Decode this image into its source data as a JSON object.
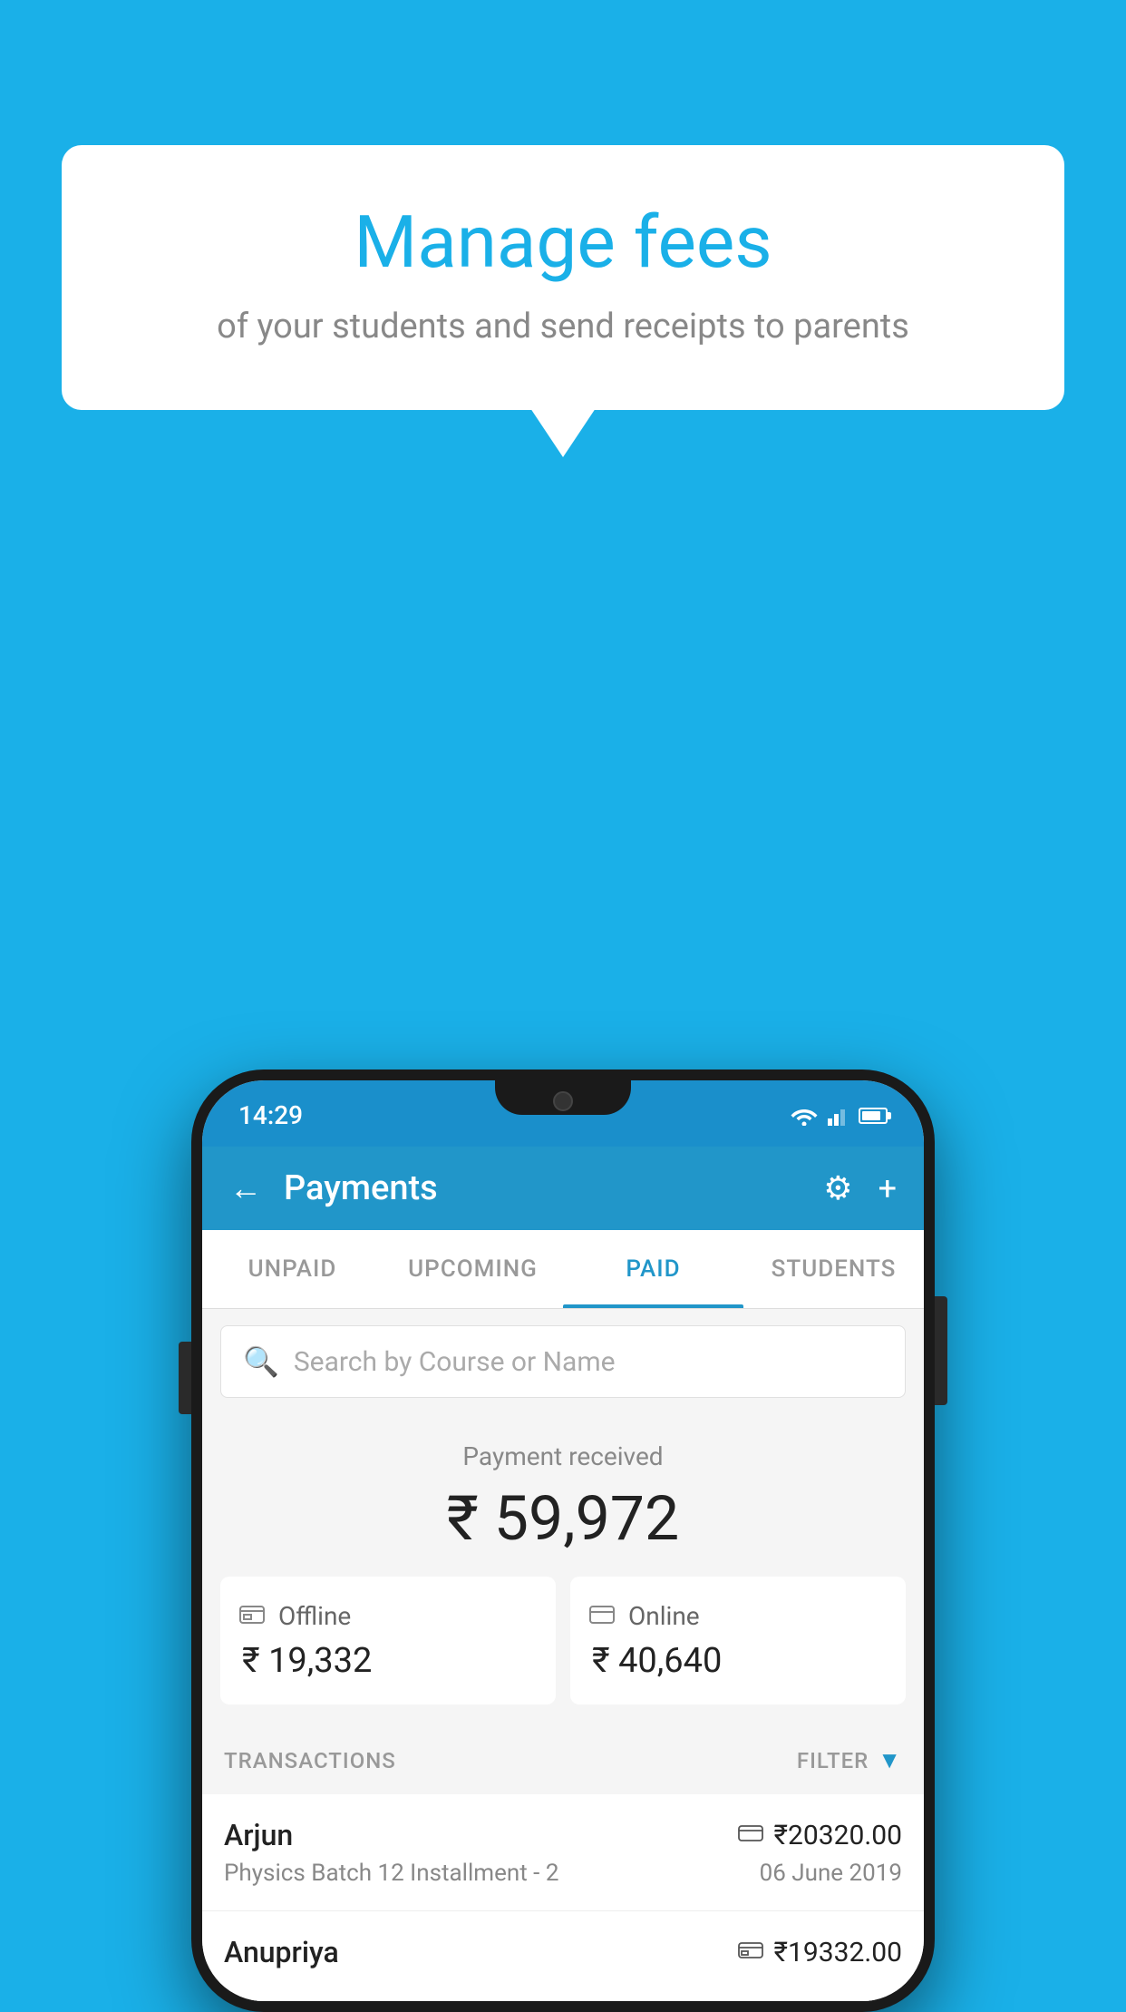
{
  "background_color": "#1ab0e8",
  "speech_bubble": {
    "title": "Manage fees",
    "subtitle": "of your students and send receipts to parents"
  },
  "status_bar": {
    "time": "14:29"
  },
  "app_bar": {
    "title": "Payments",
    "back_label": "←",
    "settings_label": "⚙",
    "add_label": "+"
  },
  "tabs": [
    {
      "label": "UNPAID",
      "active": false
    },
    {
      "label": "UPCOMING",
      "active": false
    },
    {
      "label": "PAID",
      "active": true
    },
    {
      "label": "STUDENTS",
      "active": false
    }
  ],
  "search": {
    "placeholder": "Search by Course or Name"
  },
  "payment_summary": {
    "label": "Payment received",
    "total": "₹ 59,972",
    "offline": {
      "type": "Offline",
      "amount": "₹ 19,332"
    },
    "online": {
      "type": "Online",
      "amount": "₹ 40,640"
    }
  },
  "transactions_header": {
    "label": "TRANSACTIONS",
    "filter_label": "FILTER"
  },
  "transactions": [
    {
      "name": "Arjun",
      "amount": "₹20320.00",
      "course": "Physics Batch 12 Installment - 2",
      "date": "06 June 2019",
      "payment_type": "card"
    },
    {
      "name": "Anupriya",
      "amount": "₹19332.00",
      "course": "",
      "date": "",
      "payment_type": "offline"
    }
  ]
}
